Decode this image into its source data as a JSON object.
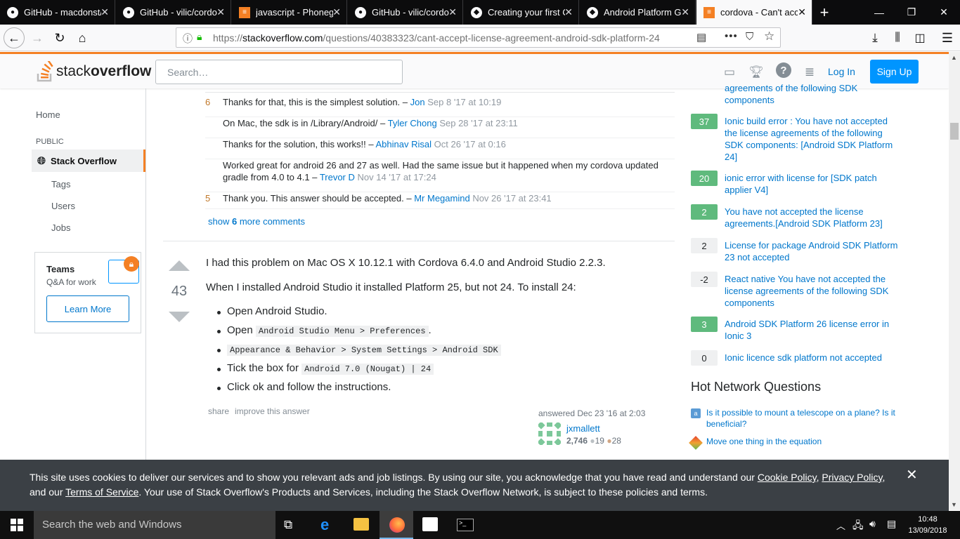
{
  "browser": {
    "tabs": [
      {
        "label": "GitHub - macdonst/",
        "icon": "github-icon"
      },
      {
        "label": "GitHub - vilic/cordo",
        "icon": "github-icon"
      },
      {
        "label": "javascript - Phoneg",
        "icon": "stackoverflow-icon"
      },
      {
        "label": "GitHub - vilic/cordo",
        "icon": "github-icon"
      },
      {
        "label": "Creating your first C",
        "icon": "cordova-icon"
      },
      {
        "label": "Android Platform G",
        "icon": "cordova-icon"
      },
      {
        "label": "cordova - Can't acc",
        "icon": "stackoverflow-icon",
        "active": true
      }
    ],
    "url_prefix": "https://",
    "url_host": "stackoverflow.com",
    "url_path": "/questions/40383323/cant-accept-license-agreement-android-sdk-platform-24"
  },
  "so_header": {
    "logo_a": "stack",
    "logo_b": "overflow",
    "search_placeholder": "Search…",
    "login": "Log In",
    "signup": "Sign Up",
    "accent": "#f48024",
    "primary": "#0095ff"
  },
  "leftnav": {
    "home": "Home",
    "public": "PUBLIC",
    "stack_overflow": "Stack Overflow",
    "tags": "Tags",
    "users": "Users",
    "jobs": "Jobs",
    "teams_title": "Teams",
    "teams_sub": "Q&A for work",
    "learn_more": "Learn More"
  },
  "comments": [
    {
      "score": "6",
      "text": "Thanks for that, this is the simplest solution. –",
      "user": "Jon",
      "date": "Sep 8 '17 at 10:19"
    },
    {
      "score": "",
      "text": "On Mac, the sdk is in /Library/Android/ –",
      "user": "Tyler Chong",
      "date": "Sep 28 '17 at 23:11"
    },
    {
      "score": "",
      "text": "Thanks for the solution, this works!! –",
      "user": "Abhinav Risal",
      "date": "Oct 26 '17 at 0:16"
    },
    {
      "score": "",
      "text": "Worked great for android 26 and 27 as well. Had the same issue but it happened when my cordova updated gradle from 4.0 to 4.1 –",
      "user": "Trevor D",
      "date": "Nov 14 '17 at 17:24"
    },
    {
      "score": "5",
      "text": "Thank you. This answer should be accepted. –",
      "user": "Mr Megamind",
      "date": "Nov 26 '17 at 23:41"
    }
  ],
  "show_more": {
    "pre": "show",
    "count": "6",
    "post": "more comments"
  },
  "answer": {
    "votes": "43",
    "p1": "I had this problem on Mac OS X 10.12.1 with Cordova 6.4.0 and Android Studio 2.2.3.",
    "p2": "When I installed Android Studio it installed Platform 25, but not 24. To install 24:",
    "b1": "Open Android Studio.",
    "b2_pre": "Open",
    "b2_code": "Android Studio Menu > Preferences",
    "b2_post": ".",
    "b3_code": "Appearance & Behavior > System Settings > Android SDK",
    "b4_pre": "Tick the box for",
    "b4_code": "Android 7.0 (Nougat) | 24",
    "b5": "Click ok and follow the instructions.",
    "share": "share",
    "improve": "improve this answer",
    "answered": "answered Dec 23 '16 at 2:03",
    "user": "jxmallett",
    "rep": "2,746",
    "silver": "19",
    "bronze": "28"
  },
  "related": [
    {
      "count": "",
      "title": "agreements of the following SDK components",
      "style": "none"
    },
    {
      "count": "37",
      "title": "Ionic build error : You have not accepted the license agreements of the following SDK components: [Android SDK Platform 24]",
      "style": "green"
    },
    {
      "count": "20",
      "title": "ionic error with license for [SDK patch applier V4]",
      "style": "green"
    },
    {
      "count": "2",
      "title": "You have not accepted the license agreements.[Android SDK Platform 23]",
      "style": "green"
    },
    {
      "count": "2",
      "title": "License for package Android SDK Platform 23 not accepted",
      "style": "gray"
    },
    {
      "count": "-2",
      "title": "React native You have not accepted the license agreements of the following SDK components",
      "style": "gray"
    },
    {
      "count": "3",
      "title": "Android SDK Platform 26 license error in Ionic 3",
      "style": "green"
    },
    {
      "count": "0",
      "title": "Ionic licence sdk platform not accepted",
      "style": "gray"
    }
  ],
  "hot": {
    "heading": "Hot Network Questions",
    "items": [
      {
        "title": "Is it possible to mount a telescope on a plane? Is it beneficial?"
      },
      {
        "title": "Move one thing in the equation"
      }
    ]
  },
  "cookie": {
    "text1": "This site uses cookies to deliver our services and to show you relevant ads and job listings. By using our site, you acknowledge that you have read and understand our",
    "cookie_policy": "Cookie Policy",
    "privacy_policy": "Privacy Policy",
    "and_our": ", and our",
    "terms": "Terms of Service",
    "text2": ". Your use of Stack Overflow's Products and Services, including the Stack Overflow Network, is subject to these policies and terms."
  },
  "taskbar": {
    "search": "Search the web and Windows",
    "time": "10:48",
    "date": "13/09/2018"
  }
}
